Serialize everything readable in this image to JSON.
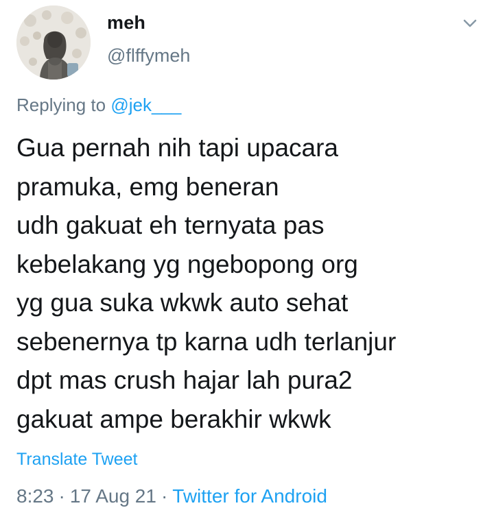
{
  "user": {
    "display_name": "meh",
    "handle": "@flffymeh"
  },
  "reply_context": {
    "prefix": "Replying to",
    "mention": "@jek___"
  },
  "tweet": {
    "lines": [
      "Gua pernah nih tapi upacara",
      "pramuka, emg beneran",
      "udh gakuat eh ternyata pas",
      "kebelakang yg ngebopong org",
      "yg gua suka wkwk auto sehat",
      "sebenernya tp karna udh terlanjur",
      "dpt mas crush hajar lah pura2",
      "gakuat ampe berakhir wkwk"
    ]
  },
  "translate_label": "Translate Tweet",
  "meta": {
    "time": "8:23",
    "separator": "·",
    "date": "17 Aug 21",
    "source": "Twitter for Android"
  },
  "icons": {
    "menu": "chevron-down-icon"
  },
  "colors": {
    "text": "#14171a",
    "secondary": "#657786",
    "link": "#1da1f2",
    "background": "#ffffff"
  }
}
